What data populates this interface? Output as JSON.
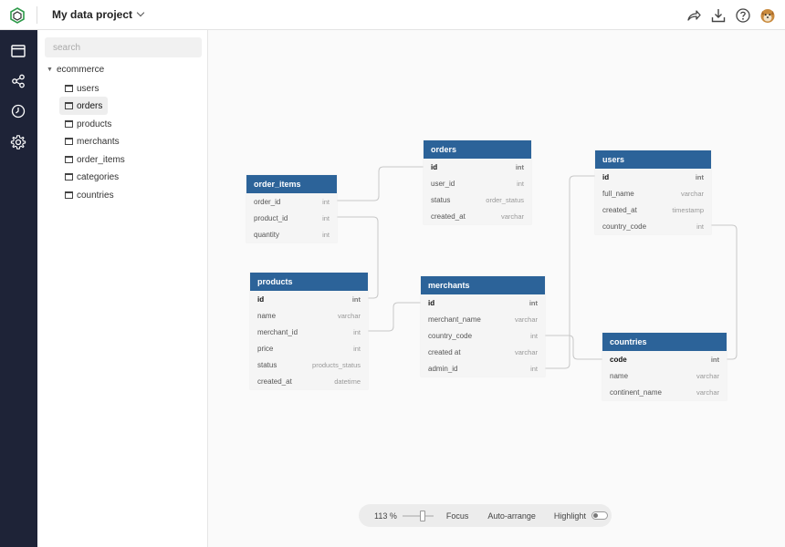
{
  "header": {
    "project_title": "My data project",
    "icons": [
      "logo-icon",
      "share-icon",
      "download-icon",
      "help-icon",
      "user-avatar"
    ]
  },
  "rail": {
    "icons": [
      "window-icon",
      "share-nodes-icon",
      "history-icon",
      "settings-icon"
    ]
  },
  "sidebar": {
    "search_placeholder": "search",
    "root_label": "ecommerce",
    "items": [
      {
        "label": "users",
        "active": false
      },
      {
        "label": "orders",
        "active": true
      },
      {
        "label": "products",
        "active": false
      },
      {
        "label": "merchants",
        "active": false
      },
      {
        "label": "order_items",
        "active": false
      },
      {
        "label": "categories",
        "active": false
      },
      {
        "label": "countries",
        "active": false
      }
    ]
  },
  "tables": {
    "order_items": {
      "name": "order_items",
      "columns": [
        {
          "name": "order_id",
          "type": "int"
        },
        {
          "name": "product_id",
          "type": "int"
        },
        {
          "name": "quantity",
          "type": "int"
        }
      ]
    },
    "orders": {
      "name": "orders",
      "columns": [
        {
          "name": "id",
          "type": "int"
        },
        {
          "name": "user_id",
          "type": "int"
        },
        {
          "name": "status",
          "type": "order_status"
        },
        {
          "name": "created_at",
          "type": "varchar"
        }
      ]
    },
    "users": {
      "name": "users",
      "columns": [
        {
          "name": "id",
          "type": "int"
        },
        {
          "name": "full_name",
          "type": "varchar"
        },
        {
          "name": "created_at",
          "type": "timestamp"
        },
        {
          "name": "country_code",
          "type": "int"
        }
      ]
    },
    "products": {
      "name": "products",
      "columns": [
        {
          "name": "id",
          "type": "int"
        },
        {
          "name": "name",
          "type": "varchar"
        },
        {
          "name": "merchant_id",
          "type": "int"
        },
        {
          "name": "price",
          "type": "int"
        },
        {
          "name": "status",
          "type": "products_status"
        },
        {
          "name": "created_at",
          "type": "datetime"
        }
      ]
    },
    "merchants": {
      "name": "merchants",
      "columns": [
        {
          "name": "id",
          "type": "int"
        },
        {
          "name": "merchant_name",
          "type": "varchar"
        },
        {
          "name": "country_code",
          "type": "int"
        },
        {
          "name": "created at",
          "type": "varchar"
        },
        {
          "name": "admin_id",
          "type": "int"
        }
      ]
    },
    "countries": {
      "name": "countries",
      "columns": [
        {
          "name": "code",
          "type": "int"
        },
        {
          "name": "name",
          "type": "varchar"
        },
        {
          "name": "continent_name",
          "type": "varchar"
        }
      ]
    }
  },
  "toolbar": {
    "zoom_label": "113 %",
    "zoom_level_percent": 113,
    "focus_label": "Focus",
    "auto_arrange_label": "Auto-arrange",
    "highlight_label": "Highlight",
    "highlight_on": false
  },
  "colors": {
    "header_blue": "#2c6399",
    "rail_dark": "#1e2337",
    "logo_green": "#2e9a4a"
  }
}
